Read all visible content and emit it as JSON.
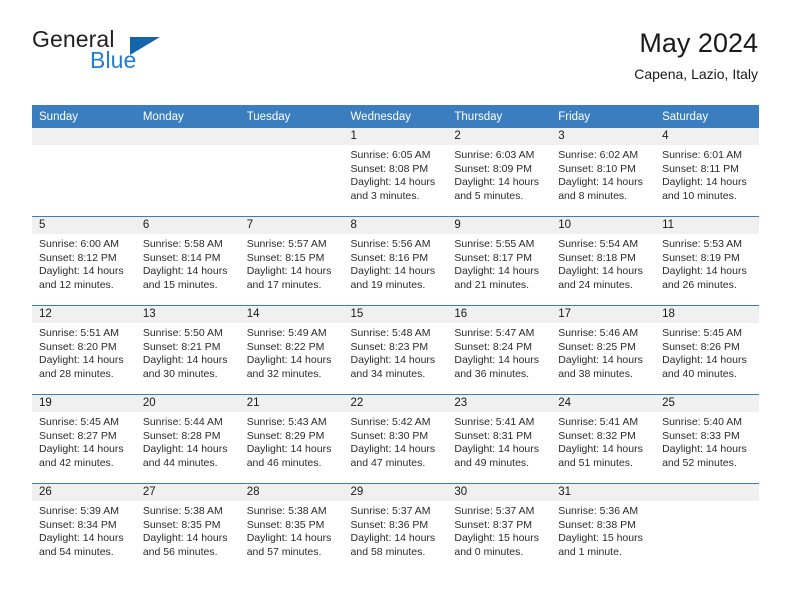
{
  "logo": {
    "word1": "General",
    "word2": "Blue",
    "triangle_color": "#1464aa",
    "word2_color": "#1f7fd0"
  },
  "header": {
    "title": "May 2024",
    "subtitle": "Capena, Lazio, Italy"
  },
  "theme": {
    "header_bg": "#3b7ec0",
    "header_text": "#ffffff",
    "daynum_bg": "#f0f0f0",
    "row_divider": "#3b7ec0"
  },
  "weekday_headers": [
    "Sunday",
    "Monday",
    "Tuesday",
    "Wednesday",
    "Thursday",
    "Friday",
    "Saturday"
  ],
  "weeks": [
    [
      {
        "day": "",
        "empty": true
      },
      {
        "day": "",
        "empty": true
      },
      {
        "day": "",
        "empty": true
      },
      {
        "day": "1",
        "sunrise": "Sunrise: 6:05 AM",
        "sunset": "Sunset: 8:08 PM",
        "daylight": "Daylight: 14 hours and 3 minutes."
      },
      {
        "day": "2",
        "sunrise": "Sunrise: 6:03 AM",
        "sunset": "Sunset: 8:09 PM",
        "daylight": "Daylight: 14 hours and 5 minutes."
      },
      {
        "day": "3",
        "sunrise": "Sunrise: 6:02 AM",
        "sunset": "Sunset: 8:10 PM",
        "daylight": "Daylight: 14 hours and 8 minutes."
      },
      {
        "day": "4",
        "sunrise": "Sunrise: 6:01 AM",
        "sunset": "Sunset: 8:11 PM",
        "daylight": "Daylight: 14 hours and 10 minutes."
      }
    ],
    [
      {
        "day": "5",
        "sunrise": "Sunrise: 6:00 AM",
        "sunset": "Sunset: 8:12 PM",
        "daylight": "Daylight: 14 hours and 12 minutes."
      },
      {
        "day": "6",
        "sunrise": "Sunrise: 5:58 AM",
        "sunset": "Sunset: 8:14 PM",
        "daylight": "Daylight: 14 hours and 15 minutes."
      },
      {
        "day": "7",
        "sunrise": "Sunrise: 5:57 AM",
        "sunset": "Sunset: 8:15 PM",
        "daylight": "Daylight: 14 hours and 17 minutes."
      },
      {
        "day": "8",
        "sunrise": "Sunrise: 5:56 AM",
        "sunset": "Sunset: 8:16 PM",
        "daylight": "Daylight: 14 hours and 19 minutes."
      },
      {
        "day": "9",
        "sunrise": "Sunrise: 5:55 AM",
        "sunset": "Sunset: 8:17 PM",
        "daylight": "Daylight: 14 hours and 21 minutes."
      },
      {
        "day": "10",
        "sunrise": "Sunrise: 5:54 AM",
        "sunset": "Sunset: 8:18 PM",
        "daylight": "Daylight: 14 hours and 24 minutes."
      },
      {
        "day": "11",
        "sunrise": "Sunrise: 5:53 AM",
        "sunset": "Sunset: 8:19 PM",
        "daylight": "Daylight: 14 hours and 26 minutes."
      }
    ],
    [
      {
        "day": "12",
        "sunrise": "Sunrise: 5:51 AM",
        "sunset": "Sunset: 8:20 PM",
        "daylight": "Daylight: 14 hours and 28 minutes."
      },
      {
        "day": "13",
        "sunrise": "Sunrise: 5:50 AM",
        "sunset": "Sunset: 8:21 PM",
        "daylight": "Daylight: 14 hours and 30 minutes."
      },
      {
        "day": "14",
        "sunrise": "Sunrise: 5:49 AM",
        "sunset": "Sunset: 8:22 PM",
        "daylight": "Daylight: 14 hours and 32 minutes."
      },
      {
        "day": "15",
        "sunrise": "Sunrise: 5:48 AM",
        "sunset": "Sunset: 8:23 PM",
        "daylight": "Daylight: 14 hours and 34 minutes."
      },
      {
        "day": "16",
        "sunrise": "Sunrise: 5:47 AM",
        "sunset": "Sunset: 8:24 PM",
        "daylight": "Daylight: 14 hours and 36 minutes."
      },
      {
        "day": "17",
        "sunrise": "Sunrise: 5:46 AM",
        "sunset": "Sunset: 8:25 PM",
        "daylight": "Daylight: 14 hours and 38 minutes."
      },
      {
        "day": "18",
        "sunrise": "Sunrise: 5:45 AM",
        "sunset": "Sunset: 8:26 PM",
        "daylight": "Daylight: 14 hours and 40 minutes."
      }
    ],
    [
      {
        "day": "19",
        "sunrise": "Sunrise: 5:45 AM",
        "sunset": "Sunset: 8:27 PM",
        "daylight": "Daylight: 14 hours and 42 minutes."
      },
      {
        "day": "20",
        "sunrise": "Sunrise: 5:44 AM",
        "sunset": "Sunset: 8:28 PM",
        "daylight": "Daylight: 14 hours and 44 minutes."
      },
      {
        "day": "21",
        "sunrise": "Sunrise: 5:43 AM",
        "sunset": "Sunset: 8:29 PM",
        "daylight": "Daylight: 14 hours and 46 minutes."
      },
      {
        "day": "22",
        "sunrise": "Sunrise: 5:42 AM",
        "sunset": "Sunset: 8:30 PM",
        "daylight": "Daylight: 14 hours and 47 minutes."
      },
      {
        "day": "23",
        "sunrise": "Sunrise: 5:41 AM",
        "sunset": "Sunset: 8:31 PM",
        "daylight": "Daylight: 14 hours and 49 minutes."
      },
      {
        "day": "24",
        "sunrise": "Sunrise: 5:41 AM",
        "sunset": "Sunset: 8:32 PM",
        "daylight": "Daylight: 14 hours and 51 minutes."
      },
      {
        "day": "25",
        "sunrise": "Sunrise: 5:40 AM",
        "sunset": "Sunset: 8:33 PM",
        "daylight": "Daylight: 14 hours and 52 minutes."
      }
    ],
    [
      {
        "day": "26",
        "sunrise": "Sunrise: 5:39 AM",
        "sunset": "Sunset: 8:34 PM",
        "daylight": "Daylight: 14 hours and 54 minutes."
      },
      {
        "day": "27",
        "sunrise": "Sunrise: 5:38 AM",
        "sunset": "Sunset: 8:35 PM",
        "daylight": "Daylight: 14 hours and 56 minutes."
      },
      {
        "day": "28",
        "sunrise": "Sunrise: 5:38 AM",
        "sunset": "Sunset: 8:35 PM",
        "daylight": "Daylight: 14 hours and 57 minutes."
      },
      {
        "day": "29",
        "sunrise": "Sunrise: 5:37 AM",
        "sunset": "Sunset: 8:36 PM",
        "daylight": "Daylight: 14 hours and 58 minutes."
      },
      {
        "day": "30",
        "sunrise": "Sunrise: 5:37 AM",
        "sunset": "Sunset: 8:37 PM",
        "daylight": "Daylight: 15 hours and 0 minutes."
      },
      {
        "day": "31",
        "sunrise": "Sunrise: 5:36 AM",
        "sunset": "Sunset: 8:38 PM",
        "daylight": "Daylight: 15 hours and 1 minute."
      },
      {
        "day": "",
        "empty": true
      }
    ]
  ]
}
